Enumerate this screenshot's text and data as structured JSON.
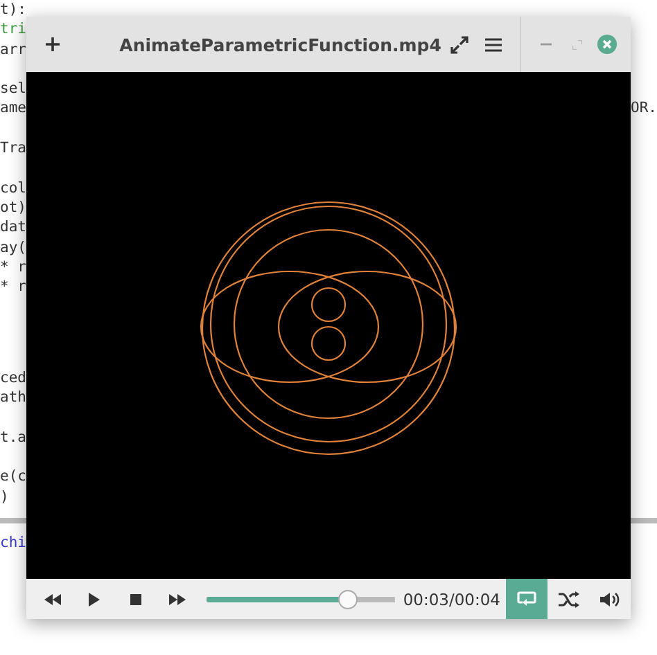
{
  "editor": {
    "top_blocks": [
      {
        "lines": [
          {
            "text": "t):"
          },
          {
            "text": "tri",
            "color": "#3f9b3f"
          },
          {
            "text": "arr"
          }
        ]
      },
      {
        "lines": [
          {
            "text": "sel"
          },
          {
            "text": "ame",
            "right": "OR."
          }
        ]
      },
      {
        "lines": [
          {
            "text": "Tra"
          }
        ]
      },
      {
        "lines": [
          {
            "text": "col"
          },
          {
            "text": "ot)"
          },
          {
            "text": "dat"
          },
          {
            "text": "ay("
          },
          {
            "text": "* r"
          },
          {
            "text": "* r"
          }
        ]
      }
    ],
    "bottom_blocks": [
      {
        "lines": [
          {
            "text": "ced"
          },
          {
            "text": "ath"
          }
        ]
      },
      {
        "lines": [
          {
            "text": "t.a"
          }
        ]
      },
      {
        "lines": [
          {
            "text": "e(c"
          },
          {
            "text": ")"
          }
        ]
      }
    ],
    "console_line": {
      "text": "chi",
      "color": "#3a3ad0"
    }
  },
  "player": {
    "title": "AnimateParametricFunction.mp4",
    "progress": {
      "level": 0.75
    },
    "time": "00:03/00:04",
    "toggles": [
      {
        "kind": "repeat",
        "selected": true
      },
      {
        "kind": "shuffle",
        "selected": false
      }
    ]
  }
}
